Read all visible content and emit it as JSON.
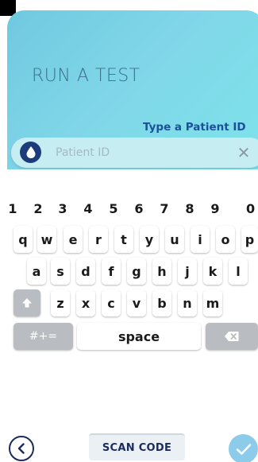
{
  "header": {
    "title": "RUN A TEST",
    "prompt": "Type a Patient ID"
  },
  "search": {
    "placeholder": "Patient ID",
    "value": "",
    "leading_icon": "blood-drop-icon",
    "clear_symbol": "✕"
  },
  "keyboard": {
    "row_numbers": [
      "1",
      "2",
      "3",
      "4",
      "5",
      "6",
      "7",
      "8",
      "9",
      "0"
    ],
    "row_top": [
      "q",
      "w",
      "e",
      "r",
      "t",
      "y",
      "u",
      "i",
      "o",
      "p"
    ],
    "row_middle": [
      "a",
      "s",
      "d",
      "f",
      "g",
      "h",
      "j",
      "k",
      "l"
    ],
    "row_bottom": [
      "z",
      "x",
      "c",
      "v",
      "b",
      "n",
      "m"
    ],
    "shift_icon": "shift-up-icon",
    "symbols_label": "#+=",
    "space_label": "space",
    "delete_icon": "backspace-icon"
  },
  "footer": {
    "back_icon": "chevron-left-icon",
    "scan_label": "SCAN CODE",
    "confirm_icon": "checkmark-icon"
  },
  "colors": {
    "header_gradient_start": "#6fc9e0",
    "header_gradient_end": "#7de3ea",
    "title_text": "#3b6f8a",
    "prompt_text": "#1d4f9a",
    "search_background": "#c6eef2",
    "drop_badge": "#1c3b7a",
    "confirm_button": "#8ccbea",
    "gray_key": "#b9bcc1"
  }
}
